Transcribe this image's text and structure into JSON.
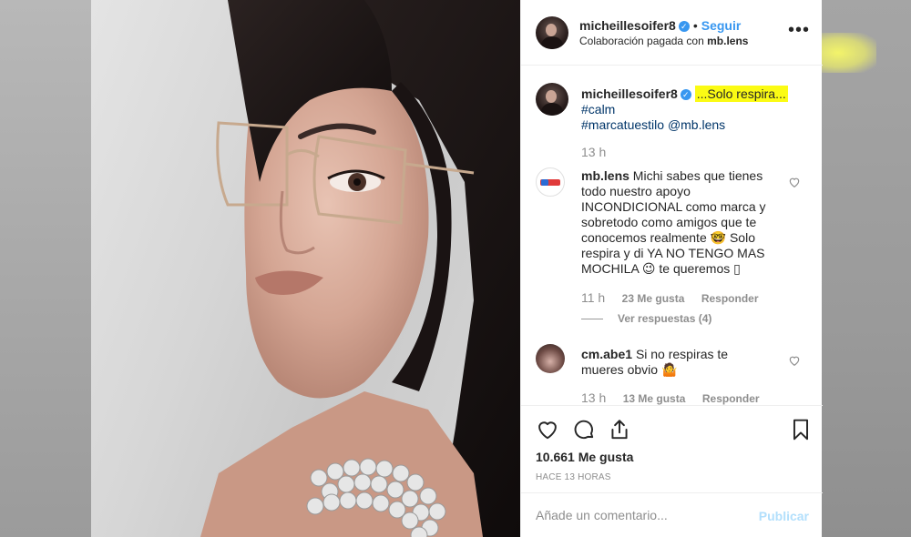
{
  "post": {
    "author": "micheillesoifer8",
    "follow_label": "Seguir",
    "dot": "•",
    "paid_partnership_prefix": "Colaboración pagada con",
    "paid_partner": "mb.lens",
    "more_label": "•••"
  },
  "caption": {
    "username": "micheillesoifer8",
    "highlighted_text": "...Solo respira...",
    "line2": "#calm",
    "line3_tag": "#marcatuestilo",
    "line3_mention": "@mb.lens",
    "time": "13 h"
  },
  "comments": [
    {
      "username": "mb.lens",
      "text_part1": "Michi sabes que tienes todo nuestro apoyo INCONDICIONAL como marca y sobretodo como amigos que te conocemos realmente",
      "emoji1": "🤓",
      "text_part2": "Solo respira y di YA NO TENGO MAS MOCHILA",
      "emoji2": "😉",
      "text_part3": "te queremos",
      "emoji3": "▯",
      "time": "11 h",
      "likes": "23 Me gusta",
      "reply_label": "Responder",
      "view_replies": "Ver respuestas (4)"
    },
    {
      "username": "cm.abe1",
      "text": "Si no respiras te mueres obvio",
      "emoji": "🤷",
      "time": "13 h",
      "likes": "13 Me gusta",
      "reply_label": "Responder"
    }
  ],
  "actions": {
    "likes_count": "10.661 Me gusta",
    "time_ago": "HACE 13 HORAS"
  },
  "add_comment": {
    "placeholder": "Añade un comentario...",
    "publish_label": "Publicar"
  },
  "colors": {
    "link_blue": "#3897f0",
    "highlight_yellow": "#fbfb14",
    "muted_gray": "#8e8e8e",
    "publish_disabled": "#b2dffc"
  }
}
